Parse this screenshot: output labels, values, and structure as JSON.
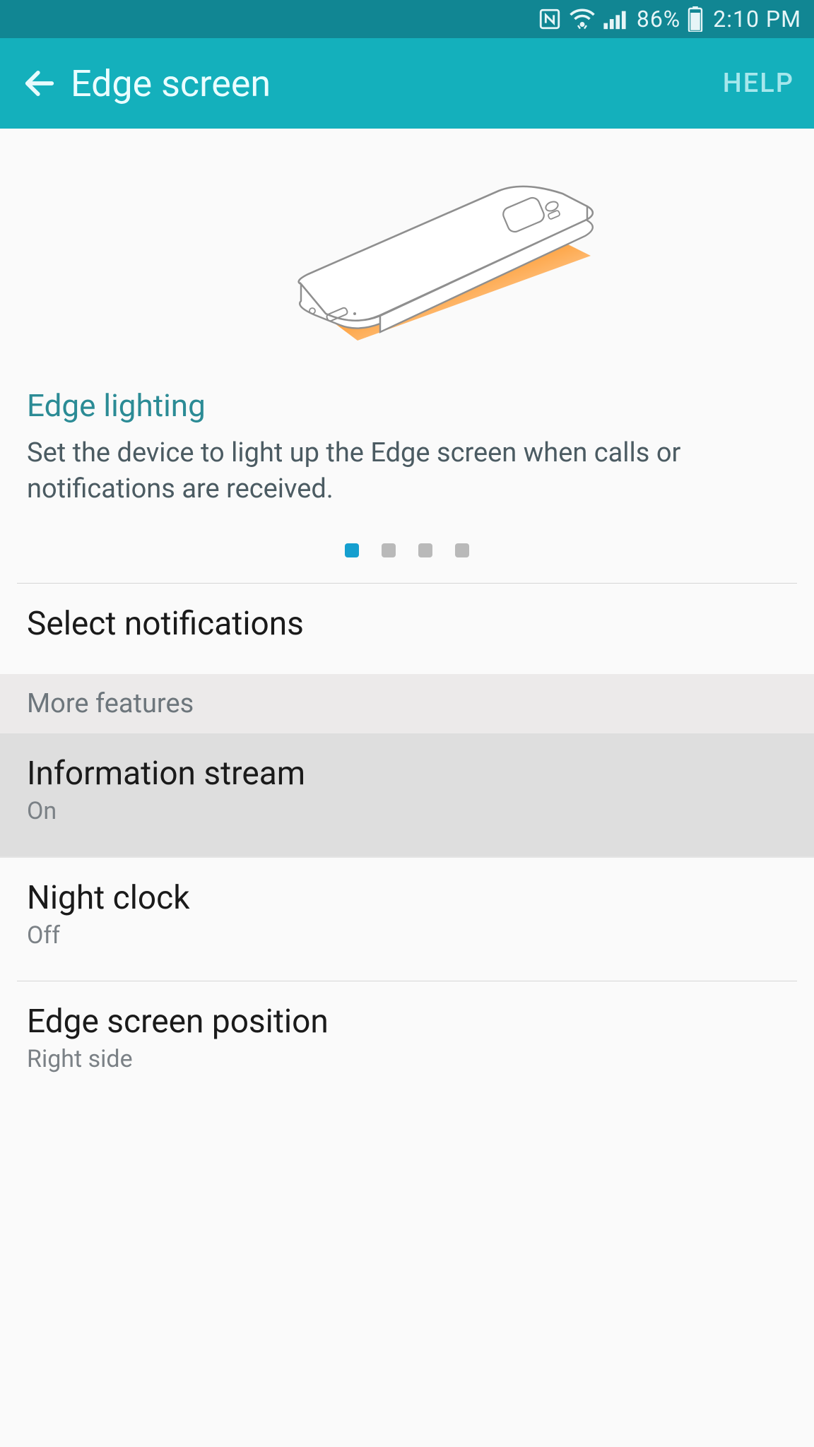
{
  "status_bar": {
    "nfc_icon": "nfc",
    "wifi_icon": "wifi",
    "signal_icon": "signal",
    "battery_pct": "86%",
    "battery_icon": "battery",
    "time": "2:10 PM"
  },
  "app_bar": {
    "back_icon": "back-arrow",
    "title": "Edge screen",
    "help_label": "HELP"
  },
  "carousel": {
    "title": "Edge lighting",
    "description": "Set the device to light up the Edge screen when calls or notifications are received.",
    "active_index": 0,
    "page_count": 4
  },
  "list": {
    "select_notifications": "Select notifications"
  },
  "section_header": "More features",
  "features": [
    {
      "title": "Information stream",
      "sub": "On",
      "selected": true
    },
    {
      "title": "Night clock",
      "sub": "Off",
      "selected": false
    },
    {
      "title": "Edge screen position",
      "sub": "Right side",
      "selected": false
    }
  ]
}
